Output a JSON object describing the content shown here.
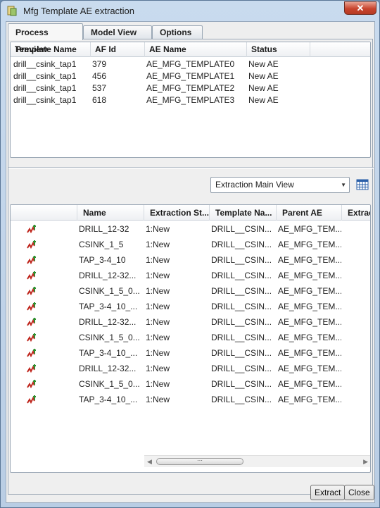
{
  "window": {
    "title": "Mfg Template AE extraction",
    "close_glyph": "✕"
  },
  "tabs": [
    {
      "label": "Process Preview",
      "active": true
    },
    {
      "label": "Model View",
      "active": false
    },
    {
      "label": "Options",
      "active": false
    }
  ],
  "process_table": {
    "columns": [
      "Template Name",
      "AF Id",
      "AE Name",
      "Status"
    ],
    "rows": [
      [
        "drill__csink_tap1",
        "379",
        "AE_MFG_TEMPLATE0",
        "New AE"
      ],
      [
        "drill__csink_tap1",
        "456",
        "AE_MFG_TEMPLATE1",
        "New AE"
      ],
      [
        "drill__csink_tap1",
        "537",
        "AE_MFG_TEMPLATE2",
        "New AE"
      ],
      [
        "drill__csink_tap1",
        "618",
        "AE_MFG_TEMPLATE3",
        "New AE"
      ]
    ]
  },
  "view_selector": {
    "value": "Extraction Main View",
    "icon": "table-columns-icon"
  },
  "extraction_table": {
    "columns": [
      "",
      "Name",
      "Extraction St...",
      "Template Na...",
      "Parent AE",
      "Extrac"
    ],
    "row_icon": "feature-icon",
    "rows": [
      [
        "DRILL_12-32",
        "1:New",
        "DRILL__CSIN...",
        "AE_MFG_TEM..."
      ],
      [
        "CSINK_1_5",
        "1:New",
        "DRILL__CSIN...",
        "AE_MFG_TEM..."
      ],
      [
        "TAP_3-4_10",
        "1:New",
        "DRILL__CSIN...",
        "AE_MFG_TEM..."
      ],
      [
        "DRILL_12-32...",
        "1:New",
        "DRILL__CSIN...",
        "AE_MFG_TEM..."
      ],
      [
        "CSINK_1_5_0...",
        "1:New",
        "DRILL__CSIN...",
        "AE_MFG_TEM..."
      ],
      [
        "TAP_3-4_10_...",
        "1:New",
        "DRILL__CSIN...",
        "AE_MFG_TEM..."
      ],
      [
        "DRILL_12-32...",
        "1:New",
        "DRILL__CSIN...",
        "AE_MFG_TEM..."
      ],
      [
        "CSINK_1_5_0...",
        "1:New",
        "DRILL__CSIN...",
        "AE_MFG_TEM..."
      ],
      [
        "TAP_3-4_10_...",
        "1:New",
        "DRILL__CSIN...",
        "AE_MFG_TEM..."
      ],
      [
        "DRILL_12-32...",
        "1:New",
        "DRILL__CSIN...",
        "AE_MFG_TEM..."
      ],
      [
        "CSINK_1_5_0...",
        "1:New",
        "DRILL__CSIN...",
        "AE_MFG_TEM..."
      ],
      [
        "TAP_3-4_10_...",
        "1:New",
        "DRILL__CSIN...",
        "AE_MFG_TEM..."
      ]
    ]
  },
  "buttons": {
    "extract": "Extract",
    "close": "Close"
  }
}
